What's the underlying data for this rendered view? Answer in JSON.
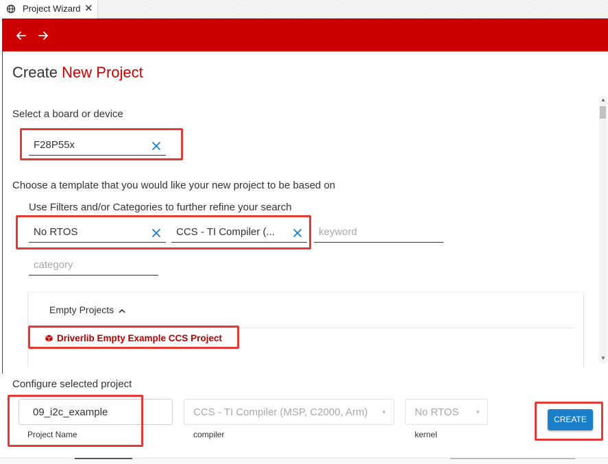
{
  "tab": {
    "title": "Project Wizard",
    "icon": "globe-icon",
    "close_glyph": "✕"
  },
  "toolbar": {
    "color": "#cc0000",
    "back_icon": "arrow-left-icon",
    "forward_icon": "arrow-right-icon"
  },
  "page": {
    "title_prefix": "Create",
    "title_accent": "New Project",
    "accent_color": "#cc0000"
  },
  "board": {
    "label": "Select a board or device",
    "value": "F28P55x",
    "clear_glyph": "×"
  },
  "template": {
    "label": "Choose a template that you would like your new project to be based on",
    "filter_hint": "Use Filters and/or Categories to further refine your search",
    "filters": [
      {
        "value": "No RTOS",
        "clear_glyph": "×"
      },
      {
        "value": "CCS - TI Compiler (...",
        "clear_glyph": "×"
      }
    ],
    "keyword_placeholder": "keyword",
    "category_placeholder": "category",
    "group": {
      "label": "Empty Projects",
      "chevron": "⌃"
    },
    "items": [
      {
        "label": "Driverlib Empty Example CCS Project",
        "icon": "cube-icon"
      }
    ]
  },
  "configure": {
    "label": "Configure selected project",
    "project_name": {
      "value": "09_i2c_example",
      "caption": "Project Name"
    },
    "compiler": {
      "value": "CCS - TI Compiler (MSP, C2000, Arm)",
      "caption": "compiler"
    },
    "kernel": {
      "value": "No RTOS",
      "caption": "kernel"
    },
    "create_label": "CREATE",
    "create_color": "#1a7ec8"
  },
  "highlight_color": "#e53935"
}
